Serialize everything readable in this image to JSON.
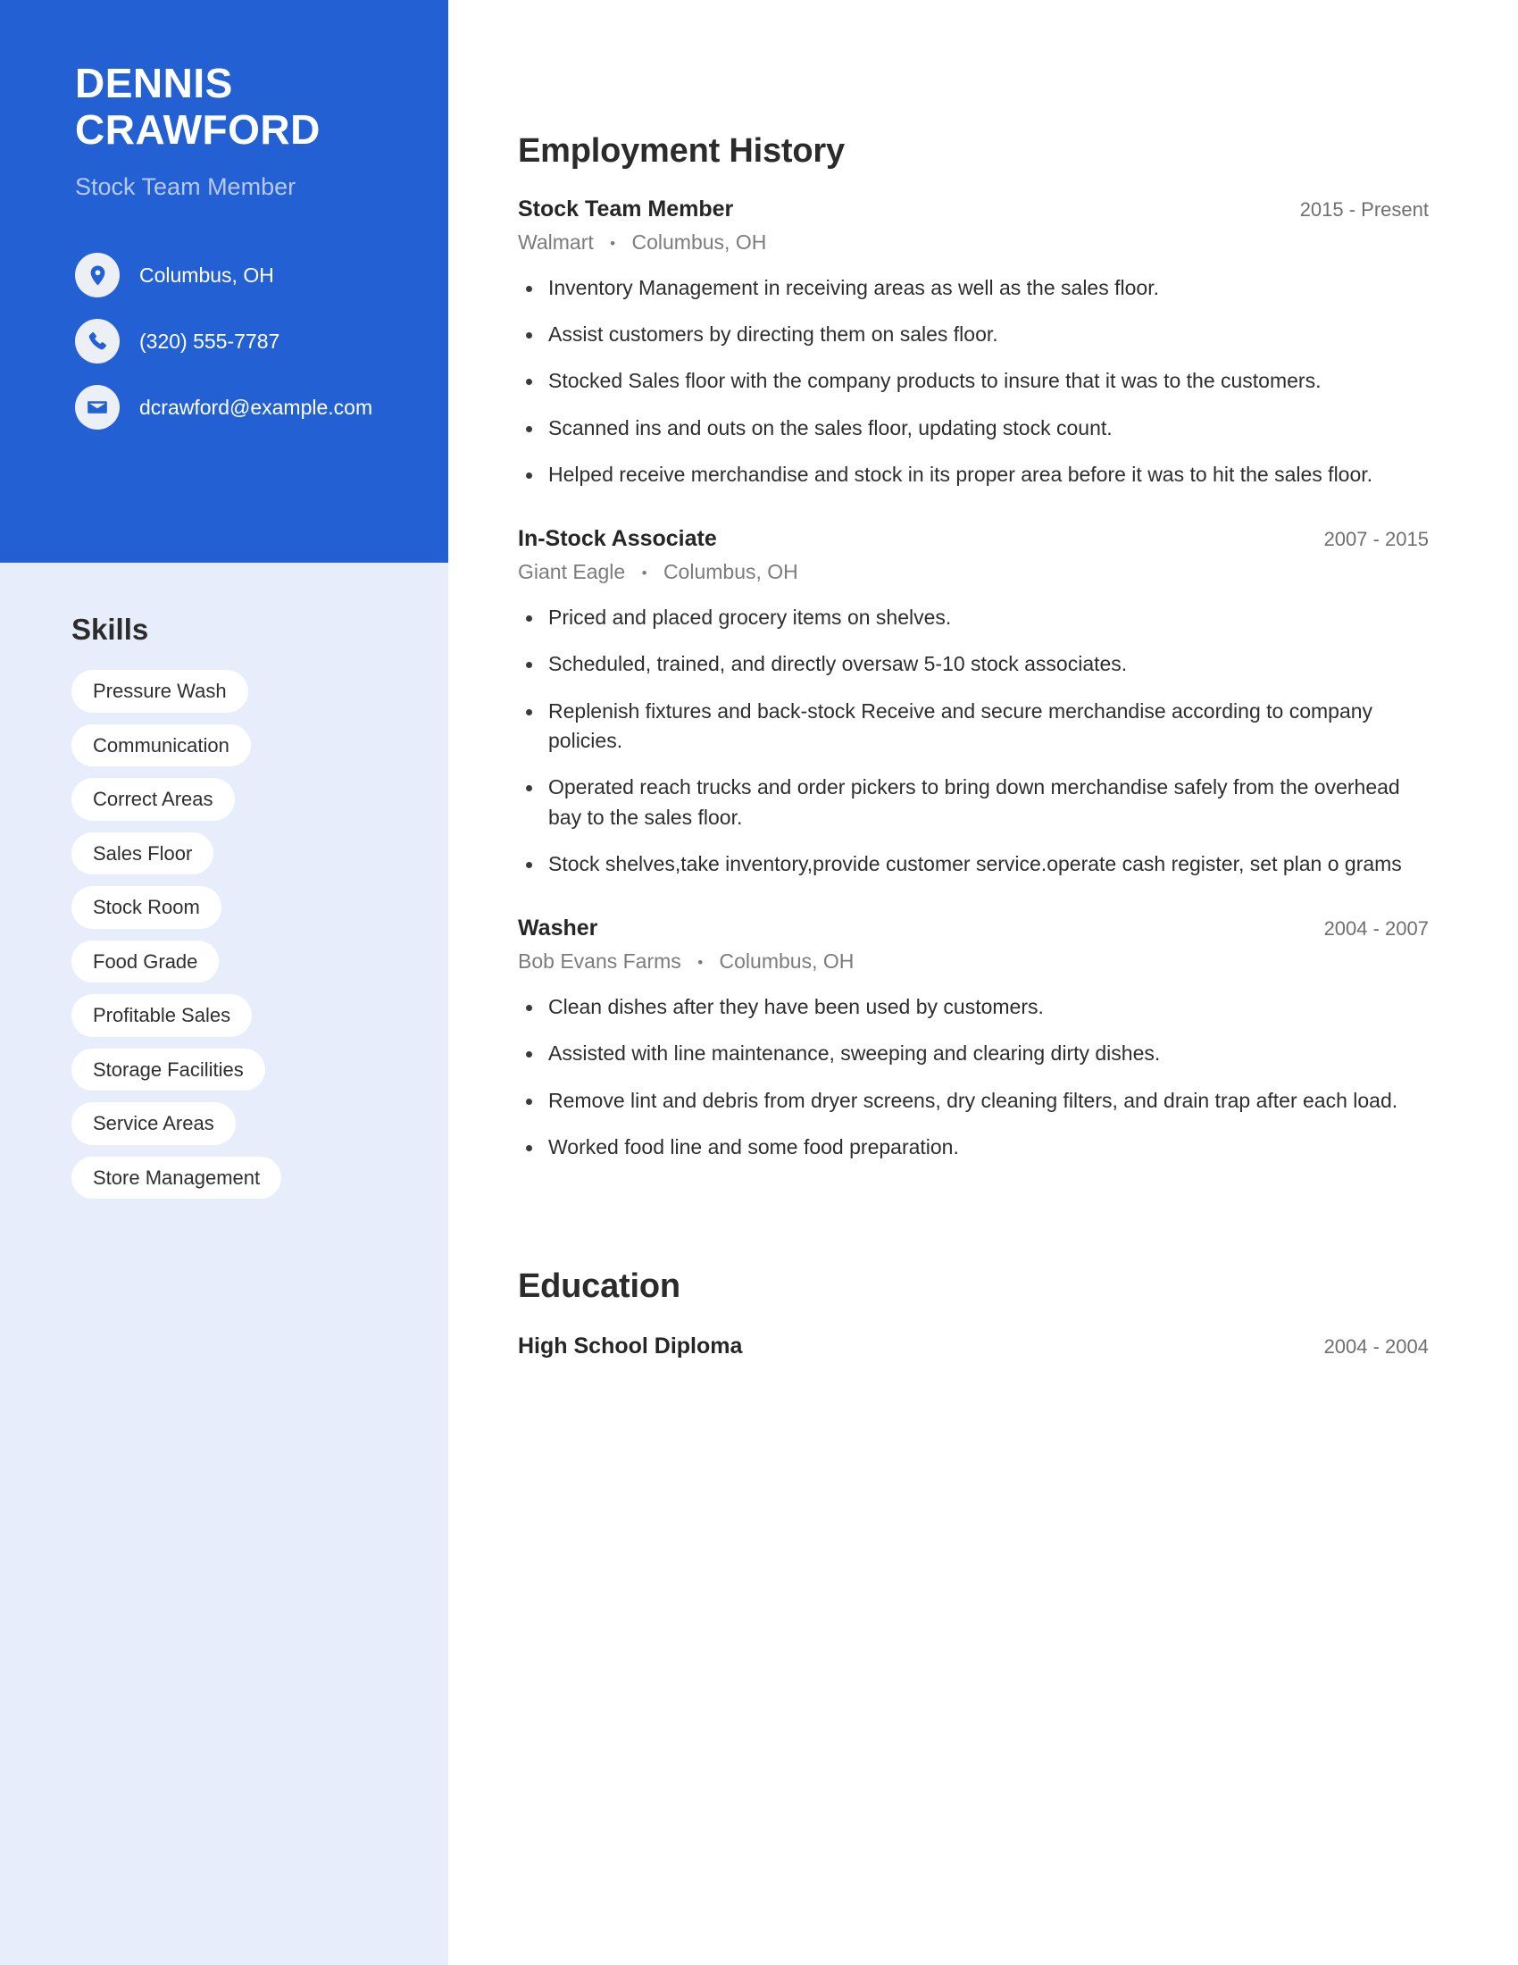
{
  "colors": {
    "header_blue": "#2260d3",
    "sidebar_light": "#e7edfa",
    "pill_white": "#ffffff",
    "subtitle_blue": "#b7c9ef",
    "body_text": "#2e2e2e",
    "muted_text": "#7c7c7c"
  },
  "sidebar": {
    "name_first": "DENNIS",
    "name_last": "CRAWFORD",
    "job_title": "Stock Team Member",
    "contact": [
      {
        "icon": "location-pin-icon",
        "value": "Columbus, OH"
      },
      {
        "icon": "phone-icon",
        "value": "(320) 555-7787"
      },
      {
        "icon": "envelope-icon",
        "value": "dcrawford@example.com"
      }
    ],
    "skills_heading": "Skills",
    "skills": [
      "Pressure Wash",
      "Communication",
      "Correct Areas",
      "Sales Floor",
      "Stock Room",
      "Food Grade",
      "Profitable Sales",
      "Storage Facilities",
      "Service Areas",
      "Store Management"
    ]
  },
  "main": {
    "employment_heading": "Employment History",
    "separator": "•",
    "jobs": [
      {
        "role": "Stock Team Member",
        "dates": "2015 - Present",
        "company": "Walmart",
        "location": "Columbus, OH",
        "bullets": [
          "Inventory Management in receiving areas as well as the sales floor.",
          "Assist customers by directing them on sales floor.",
          "Stocked Sales floor with the company products to insure that it was to the customers.",
          "Scanned ins and outs on the sales floor, updating stock count.",
          "Helped receive merchandise and stock in its proper area before it was to hit the sales floor."
        ]
      },
      {
        "role": "In-Stock Associate",
        "dates": "2007 - 2015",
        "company": "Giant Eagle",
        "location": "Columbus, OH",
        "bullets": [
          "Priced and placed grocery items on shelves.",
          "Scheduled, trained, and directly oversaw 5-10 stock associates.",
          "Replenish fixtures and back-stock Receive and secure merchandise according to company policies.",
          "Operated reach trucks and order pickers to bring down merchandise safely from the overhead bay to the sales floor.",
          "Stock shelves,take inventory,provide customer service.operate cash register, set plan o grams"
        ]
      },
      {
        "role": "Washer",
        "dates": "2004 - 2007",
        "company": "Bob Evans Farms",
        "location": "Columbus, OH",
        "bullets": [
          "Clean dishes after they have been used by customers.",
          "Assisted with line maintenance, sweeping and clearing dirty dishes.",
          "Remove lint and debris from dryer screens, dry cleaning filters, and drain trap after each load.",
          "Worked food line and some food preparation."
        ]
      }
    ],
    "education_heading": "Education",
    "education": [
      {
        "degree": "High School Diploma",
        "dates": "2004 - 2004"
      }
    ]
  }
}
